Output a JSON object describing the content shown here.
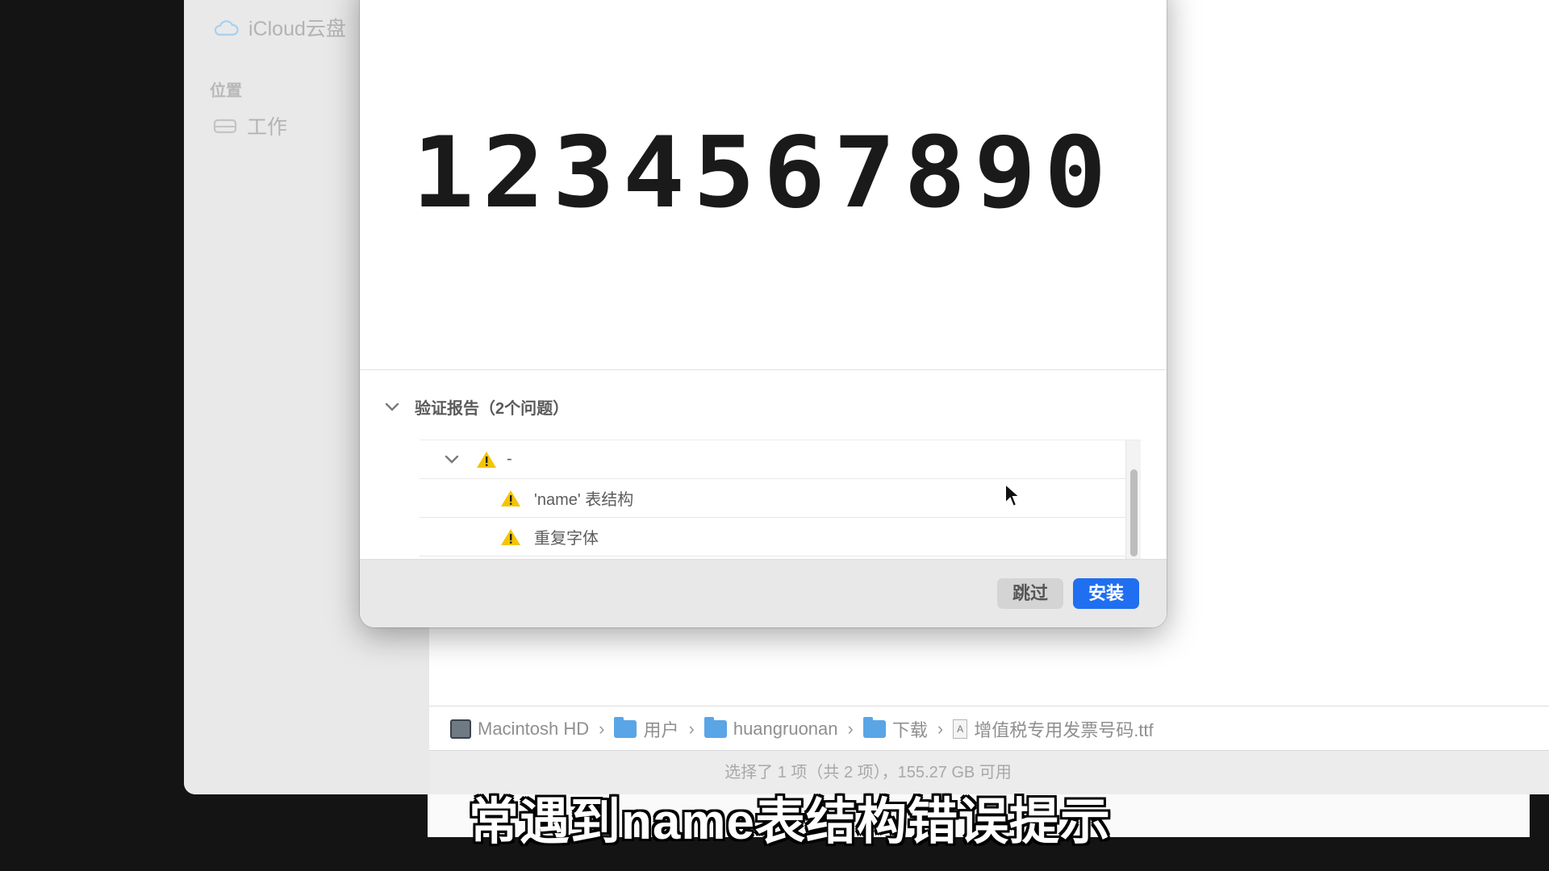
{
  "sidebar": {
    "icloud_label": "iCloud云盘",
    "locations_header": "位置",
    "work_label": "工作"
  },
  "dialog": {
    "preview_text": "1234567890",
    "report_title": "验证报告（2个问题）",
    "group_label": "-",
    "issues": [
      "'name' 表结构",
      "重复字体"
    ],
    "skip_label": "跳过",
    "install_label": "安装"
  },
  "pathbar": {
    "items": [
      "Macintosh HD",
      "用户",
      "huangruonan",
      "下载",
      "增值税专用发票号码.ttf"
    ],
    "separator": "›"
  },
  "status": "选择了 1 项（共 2 项），155.27 GB 可用",
  "subtitle": "常遇到name表结构错误提示",
  "colors": {
    "accent": "#1f6ff0",
    "warning": "#f5c400"
  }
}
